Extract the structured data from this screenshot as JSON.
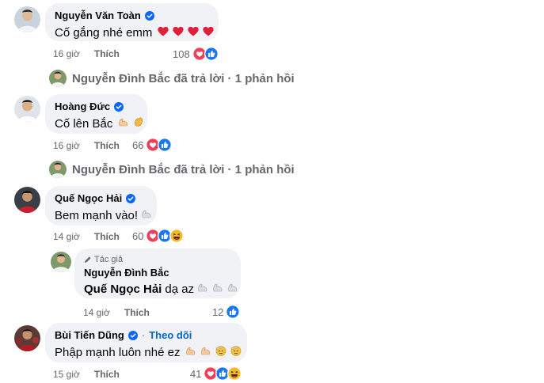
{
  "comments": [
    {
      "name": "Nguyễn Văn Toàn",
      "text": "Cố gắng nhé emm",
      "time": "16 giờ",
      "like": "Thích",
      "reactions": "108"
    },
    {
      "name": "Hoàng Đức",
      "text": "Cố lên Bắc",
      "time": "16 giờ",
      "like": "Thích",
      "reactions": "66"
    },
    {
      "name": "Quế Ngọc Hải",
      "text": "Bem mạnh vào!",
      "time": "14 giờ",
      "like": "Thích",
      "reactions": "60"
    },
    {
      "name": "Bùi Tiến Dũng",
      "follow": "Theo dõi",
      "separator": "·",
      "text": "Phập mạnh luôn nhé ez",
      "time": "15 giờ",
      "like": "Thích",
      "reactions": "41"
    }
  ],
  "reply_summaries": [
    {
      "text": "Nguyễn Đình Bắc đã trả lời · 1 phản hồi"
    },
    {
      "text": "Nguyễn Đình Bắc đã trả lời · 1 phản hồi"
    }
  ],
  "reply": {
    "author_tag": "Tác giả",
    "name": "Nguyễn Đình Bắc",
    "mention": "Quế Ngọc Hải",
    "text": "dạ az",
    "time": "14 giờ",
    "like": "Thích",
    "reactions": "12"
  },
  "colors": {
    "bubble": "#f0f2f5",
    "verified": "#0866ff",
    "like_blue": "#1877f2",
    "love_red": "#f33e58",
    "follow": "#0064d1",
    "meta": "#65676b"
  }
}
